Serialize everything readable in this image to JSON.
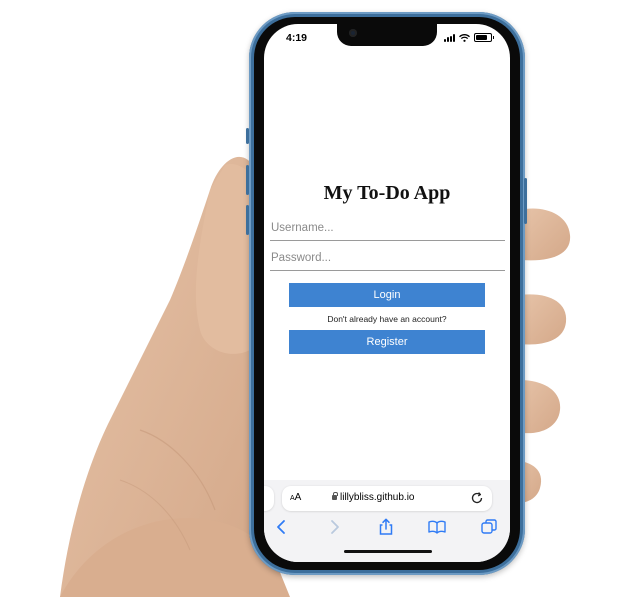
{
  "status_bar": {
    "time": "4:19"
  },
  "app": {
    "title": "My To-Do App",
    "username_placeholder": "Username...",
    "password_placeholder": "Password...",
    "login_label": "Login",
    "no_account_text": "Don't already have an account?",
    "register_label": "Register"
  },
  "browser": {
    "text_size_label_small": "A",
    "text_size_label_large": "A",
    "url": "lillybliss.github.io"
  },
  "colors": {
    "accent": "#3e83d1",
    "phone_frame": "#3d6f9c",
    "toolbar_icon": "#2f7bf5"
  }
}
